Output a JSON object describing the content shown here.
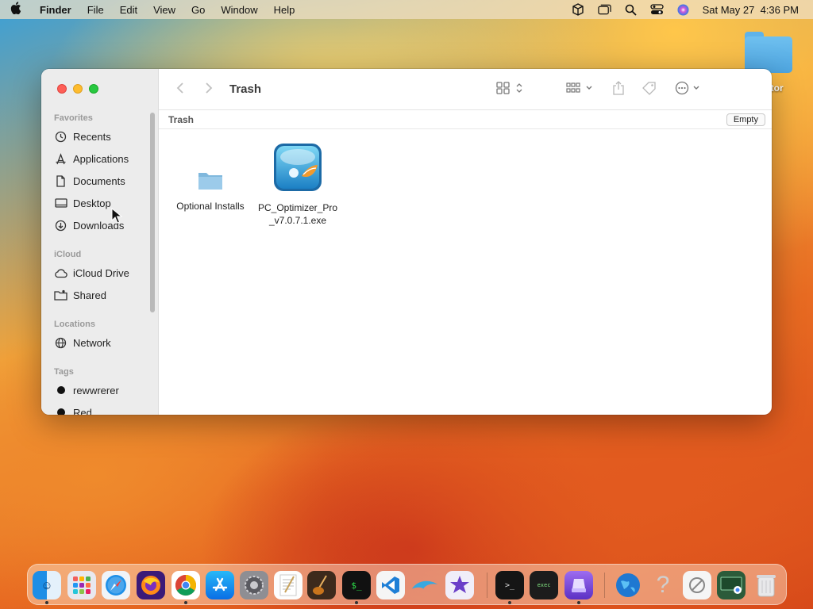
{
  "menubar": {
    "app_name": "Finder",
    "menus": [
      "File",
      "Edit",
      "View",
      "Go",
      "Window",
      "Help"
    ],
    "clock": "Sat May 27  4:36 PM",
    "status_icons": [
      "box-icon",
      "window-icon",
      "search-icon",
      "control-center-icon",
      "siri-icon"
    ]
  },
  "desktop": {
    "folder_label": "urator"
  },
  "finder": {
    "title": "Trash",
    "path_crumb": "Trash",
    "empty_label": "Empty",
    "sidebar": {
      "favorites_header": "Favorites",
      "favorites": [
        {
          "label": "Recents",
          "icon": "clock-icon"
        },
        {
          "label": "Applications",
          "icon": "applications-icon"
        },
        {
          "label": "Documents",
          "icon": "document-icon"
        },
        {
          "label": "Desktop",
          "icon": "desktop-icon"
        },
        {
          "label": "Downloads",
          "icon": "download-icon"
        }
      ],
      "icloud_header": "iCloud",
      "icloud": [
        {
          "label": "iCloud Drive",
          "icon": "cloud-icon"
        },
        {
          "label": "Shared",
          "icon": "shared-folder-icon"
        }
      ],
      "locations_header": "Locations",
      "locations": [
        {
          "label": "Network",
          "icon": "globe-icon"
        }
      ],
      "tags_header": "Tags",
      "tags": [
        {
          "label": "rewwrerer",
          "color": "#111111"
        },
        {
          "label": "Red",
          "color": "#111111"
        }
      ]
    },
    "files": [
      {
        "name": "Optional Installs",
        "type": "folder"
      },
      {
        "name_line1": "PC_Optimizer_Pro",
        "name_line2": "_v7.0.7.1.exe",
        "type": "exe"
      }
    ]
  },
  "dock": {
    "apps": [
      "Finder",
      "Launchpad",
      "Safari",
      "Firefox",
      "Chrome",
      "App Store",
      "System Settings",
      "TextEdit",
      "Instruments",
      "Terminal",
      "VS Code",
      "Dolphin",
      "iMovie",
      "Terminal 2",
      "Exec",
      "Disk Utility",
      "Network Radar",
      "Help",
      "Preview",
      "Chrome Remote",
      "Trash"
    ]
  }
}
